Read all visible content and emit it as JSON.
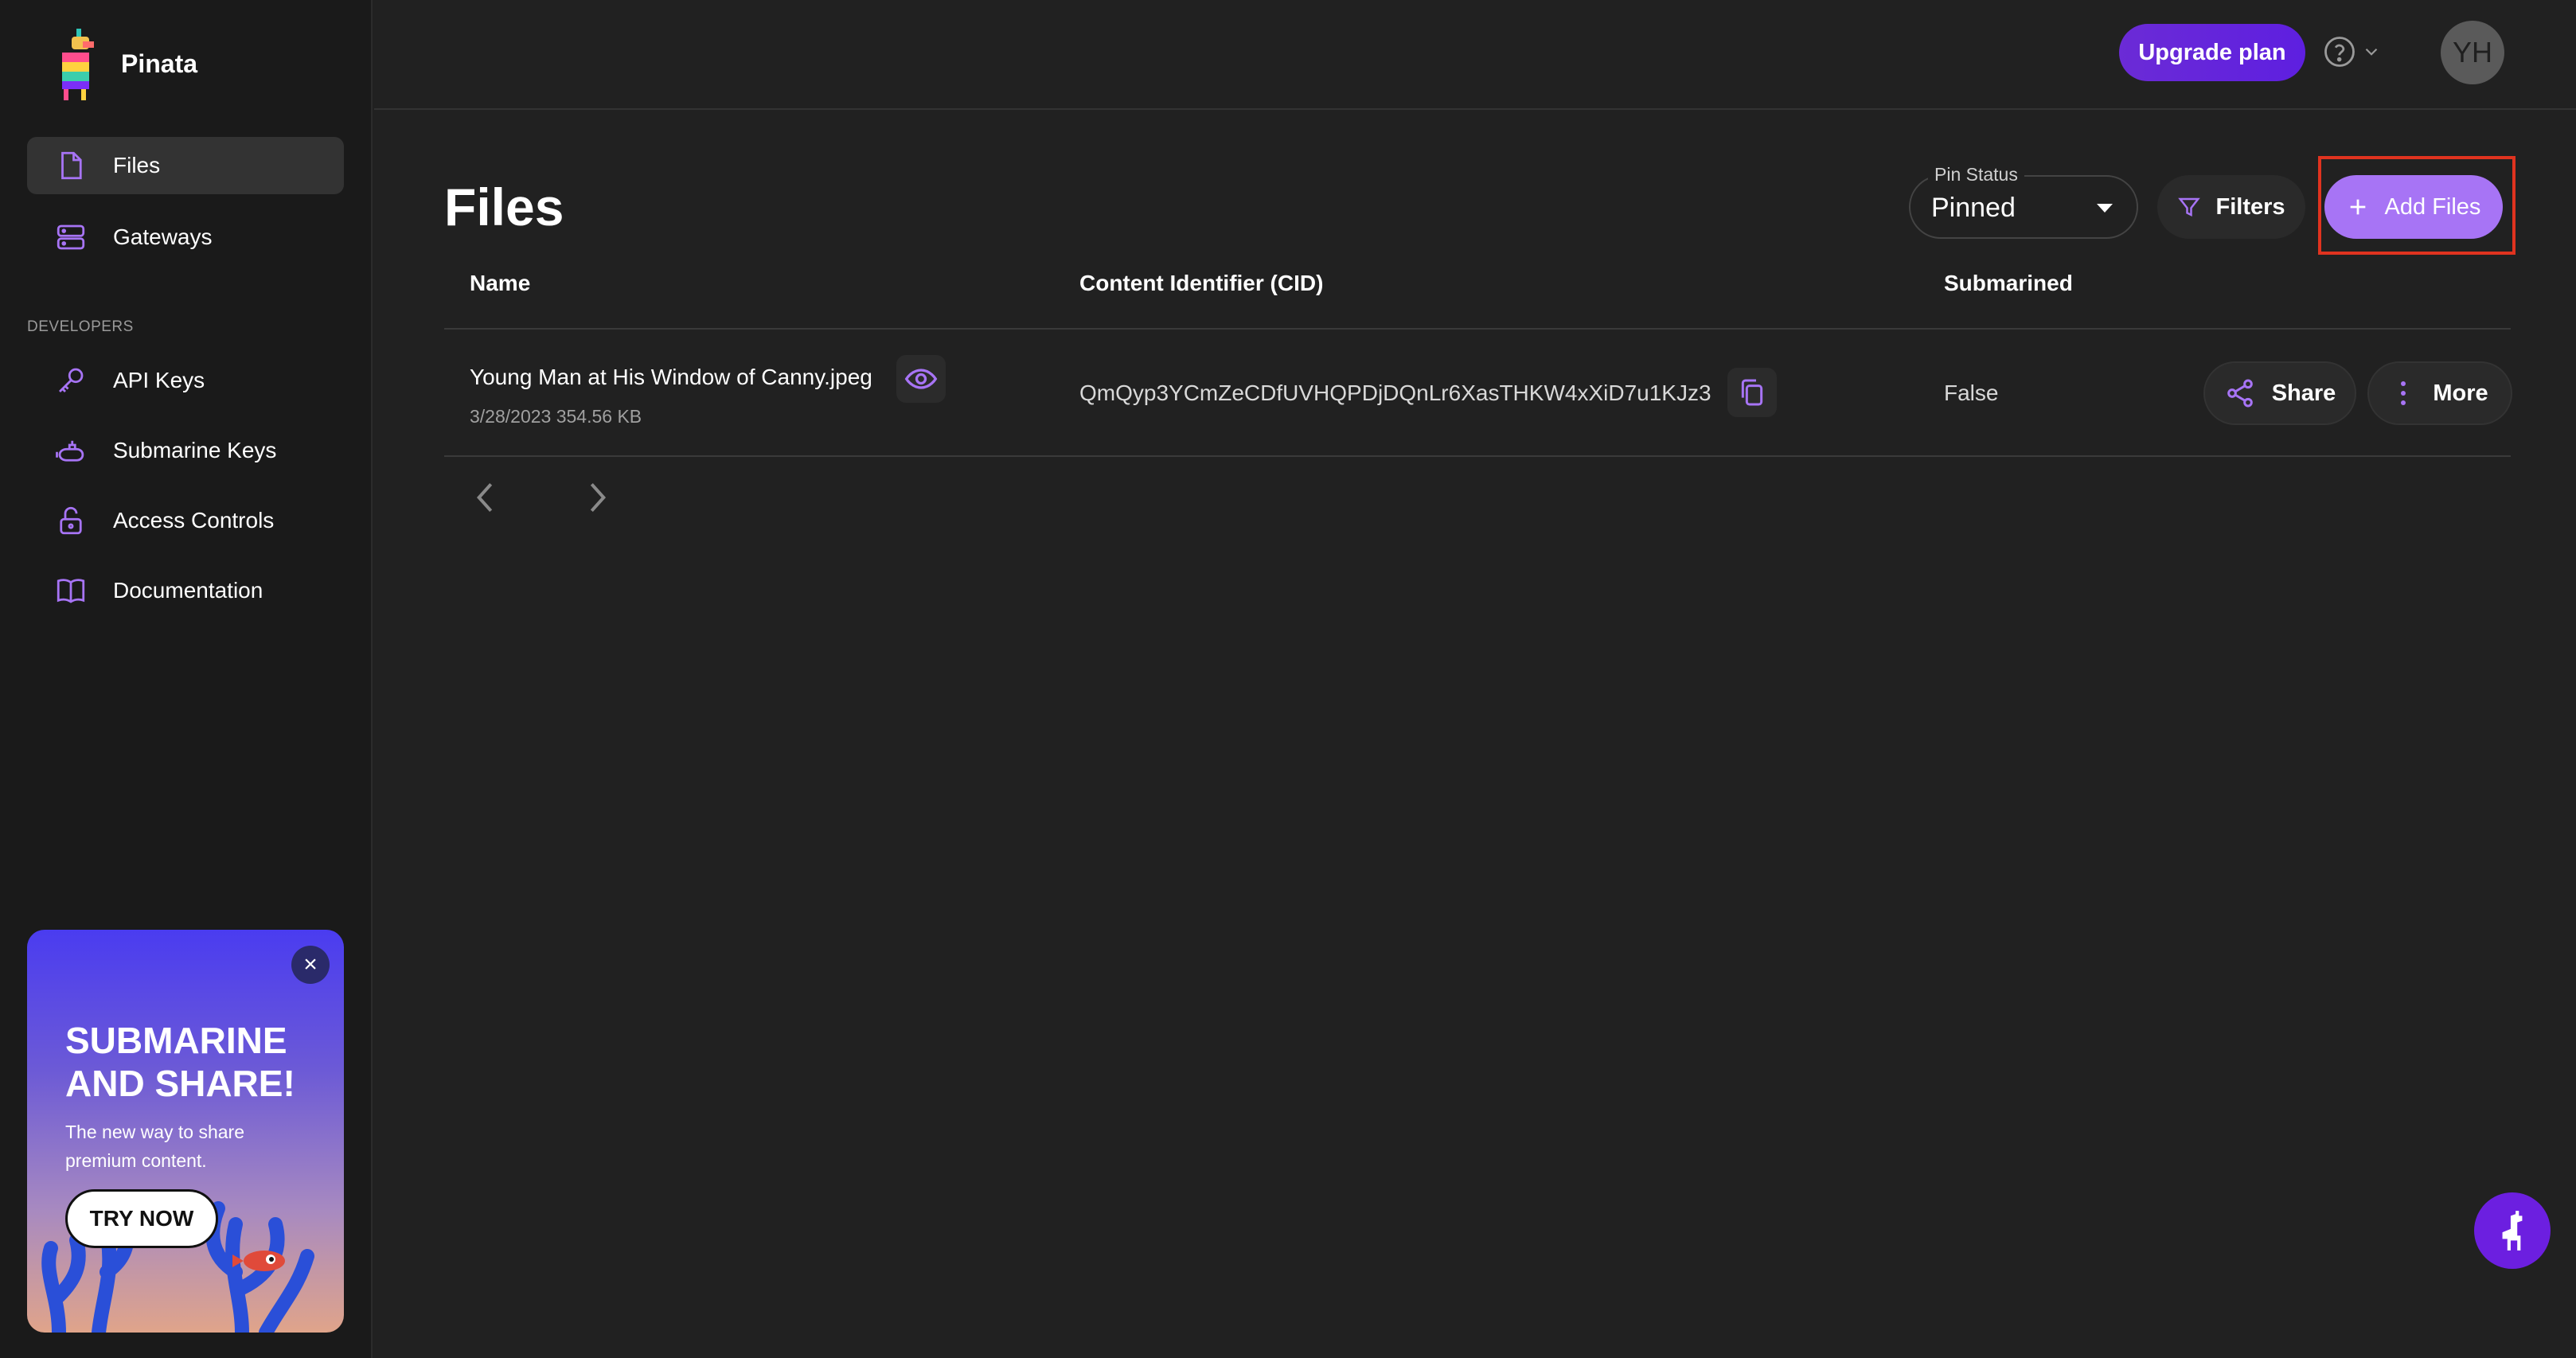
{
  "brand": {
    "name": "Pinata"
  },
  "sidebar": {
    "items": [
      {
        "label": "Files",
        "icon": "file-icon",
        "active": true
      },
      {
        "label": "Gateways",
        "icon": "server-icon"
      }
    ],
    "section_label": "DEVELOPERS",
    "dev_items": [
      {
        "label": "API Keys",
        "icon": "key-icon"
      },
      {
        "label": "Submarine Keys",
        "icon": "submarine-icon"
      },
      {
        "label": "Access Controls",
        "icon": "lock-icon"
      },
      {
        "label": "Documentation",
        "icon": "book-icon"
      }
    ]
  },
  "promo": {
    "title": "SUBMARINE AND SHARE!",
    "subtitle": "The new way to share premium content.",
    "cta": "TRY NOW",
    "close": "×"
  },
  "topbar": {
    "upgrade_label": "Upgrade plan",
    "avatar_initials": "YH"
  },
  "main": {
    "title": "Files",
    "pin_status": {
      "label": "Pin Status",
      "value": "Pinned"
    },
    "filters_label": "Filters",
    "add_files_label": "Add Files"
  },
  "table": {
    "columns": [
      "Name",
      "Content Identifier (CID)",
      "Submarined"
    ],
    "rows": [
      {
        "name": "Young Man at His Window of Canny.jpeg",
        "meta": "3/28/2023 354.56 KB",
        "cid": "QmQyp3YCmZeCDfUVHQPDjDQnLr6XasTHKW4xXiD7u1KJz3",
        "submarined": "False",
        "share_label": "Share",
        "more_label": "More"
      }
    ]
  },
  "colors": {
    "accent": "#a774f5",
    "upgrade": "#6b2bd6",
    "highlight_frame": "#e0331f",
    "background": "#212121",
    "sidebar": "#1a1a1a"
  }
}
